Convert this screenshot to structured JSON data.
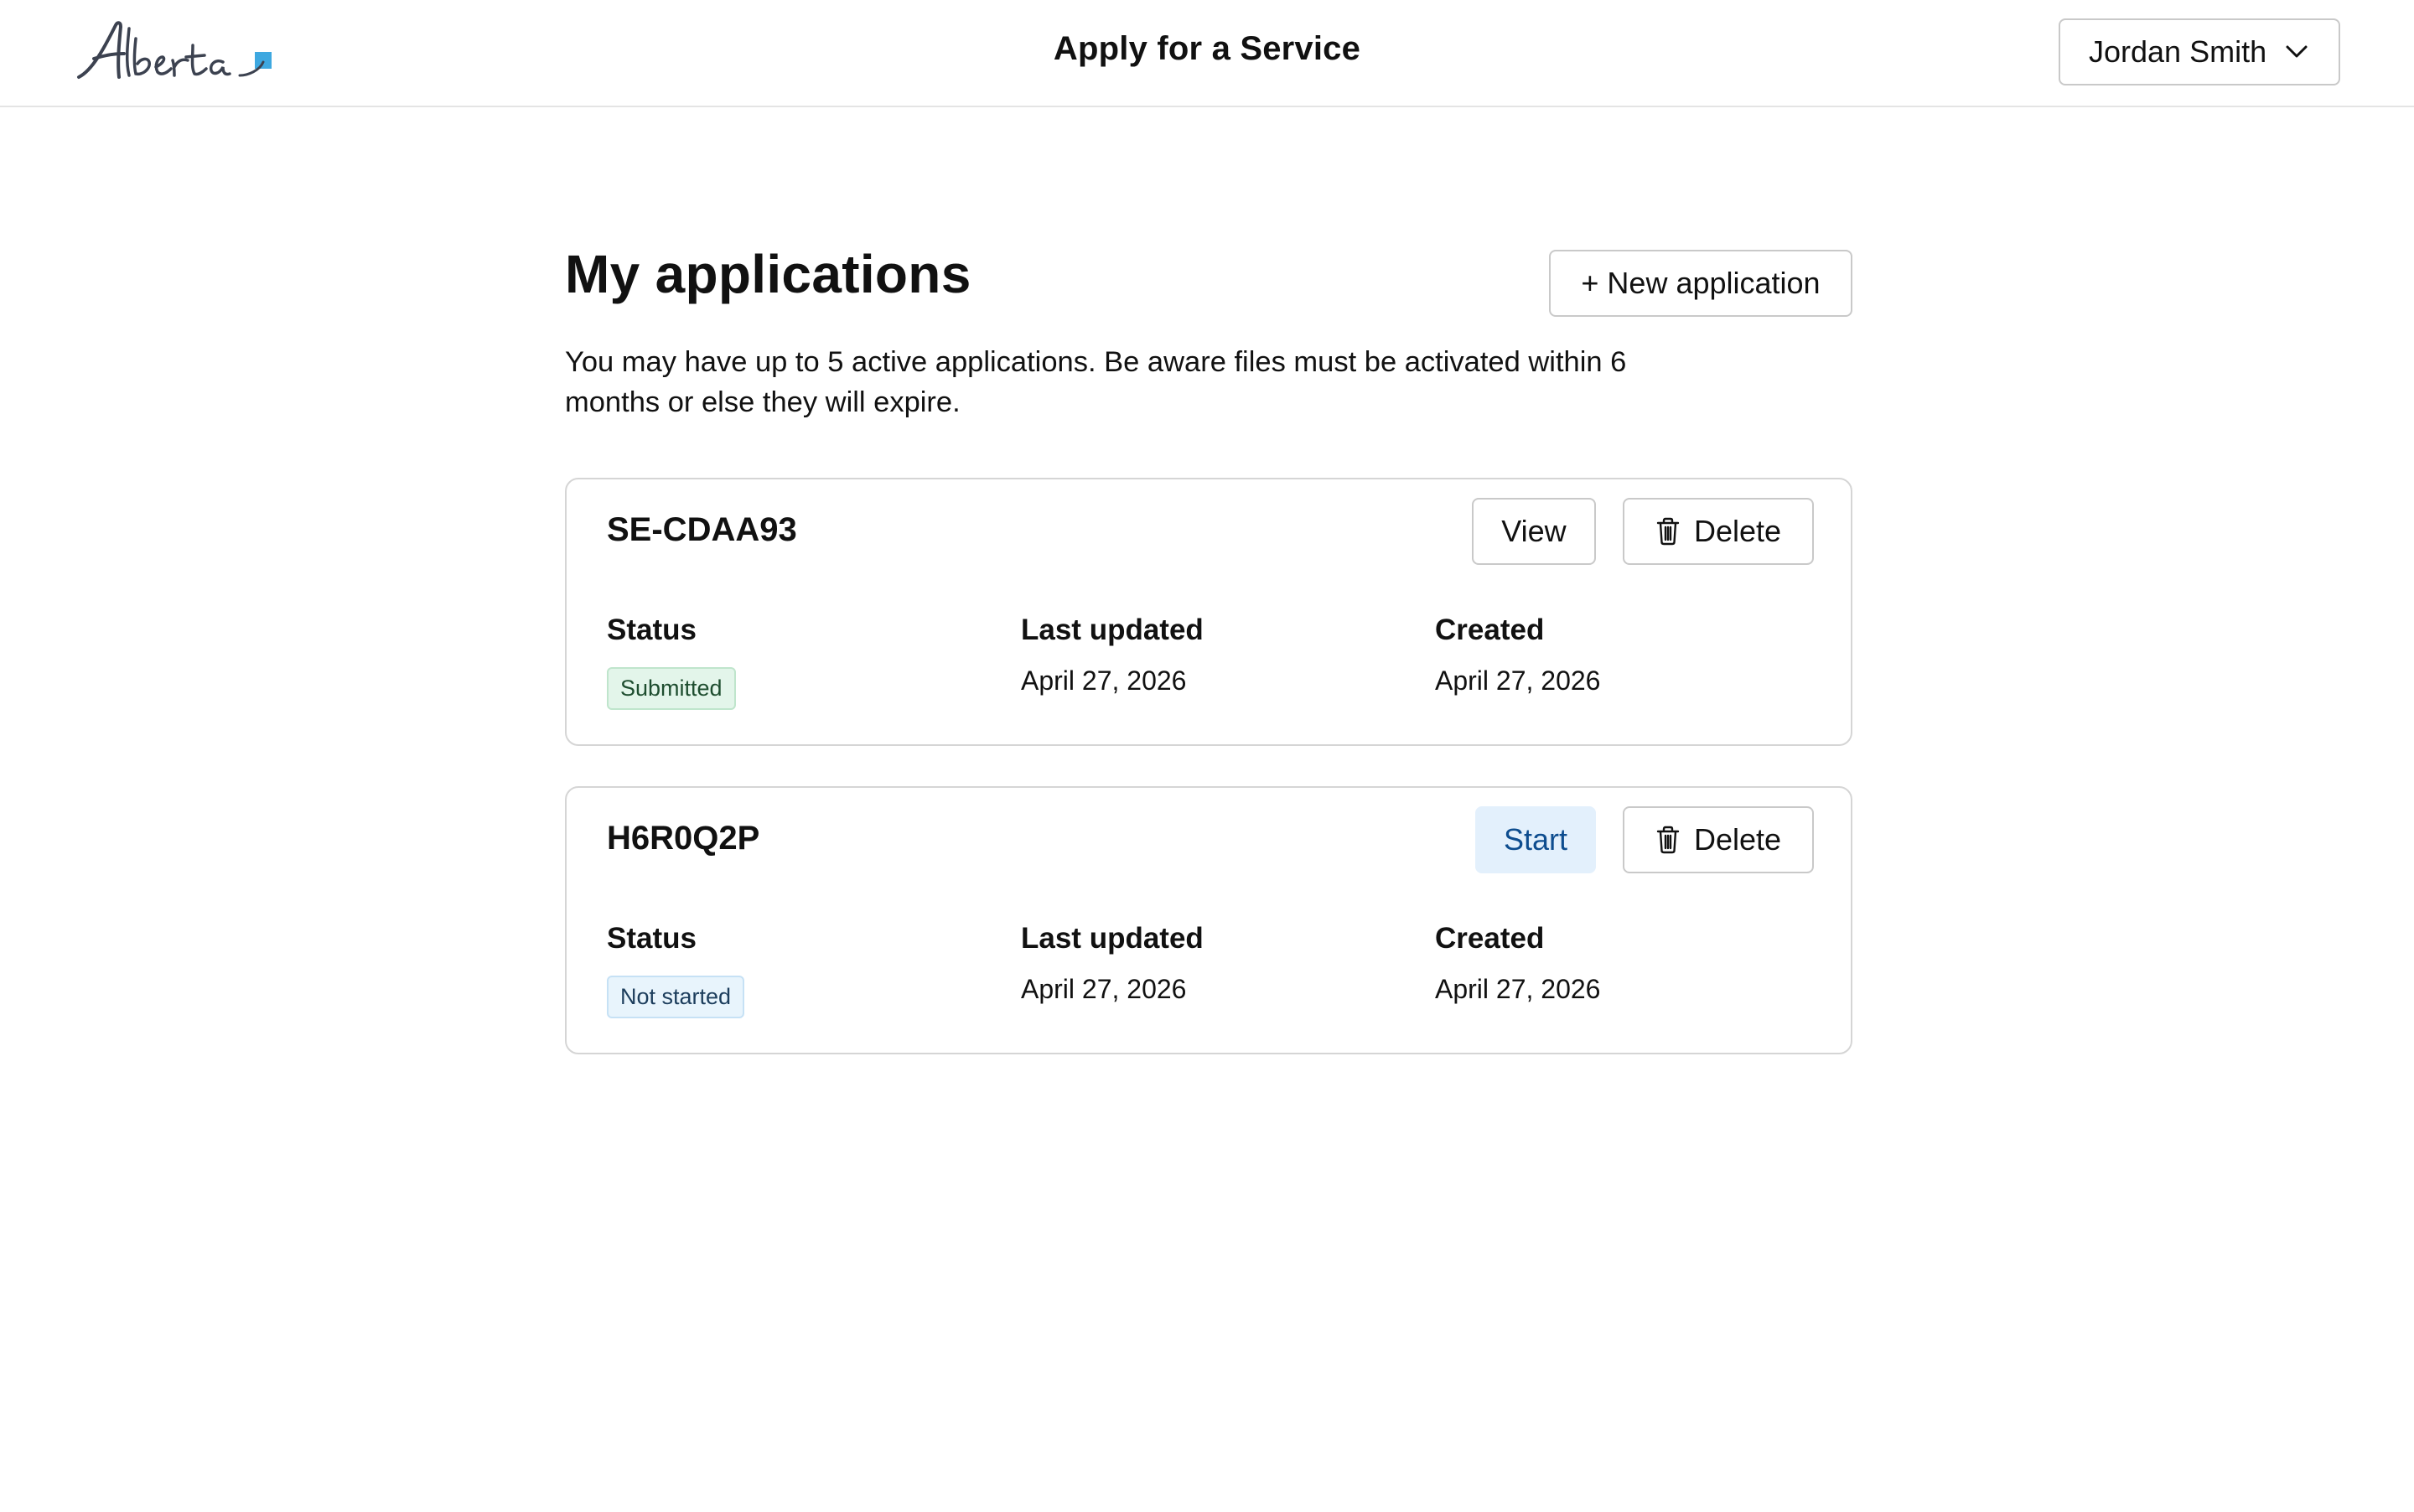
{
  "header": {
    "logo_text": "Alberta",
    "title": "Apply for a Service",
    "user_name": "Jordan Smith",
    "user_menu_icon": "chevron-down-icon"
  },
  "page": {
    "title": "My applications",
    "new_application_label": "+ New application",
    "intro": "You may have up to 5 active applications. Be aware files must be activated within 6 months or else they will expire."
  },
  "applications": [
    {
      "id": "SE-CDAA93",
      "primary_action": "View",
      "delete_label": "Delete",
      "status_label": "Status",
      "status": "Submitted",
      "last_updated_label": "Last updated",
      "last_updated": "April 27, 2026",
      "created_label": "Created",
      "created": "April 27, 2026"
    },
    {
      "id": "H6R0Q2P",
      "primary_action": "Start",
      "delete_label": "Delete",
      "status_label": "Status",
      "status": "Not started",
      "last_updated_label": "Last updated",
      "last_updated": "April 27, 2026",
      "created_label": "Created",
      "created": "April 27, 2026"
    }
  ],
  "colors": {
    "accent_blue": "#0e4d8f",
    "start_bg": "#e3f0fc",
    "submitted_bg": "#e3f5ea",
    "not_started_bg": "#e8f4fc",
    "logo_square": "#3ea8e0"
  }
}
